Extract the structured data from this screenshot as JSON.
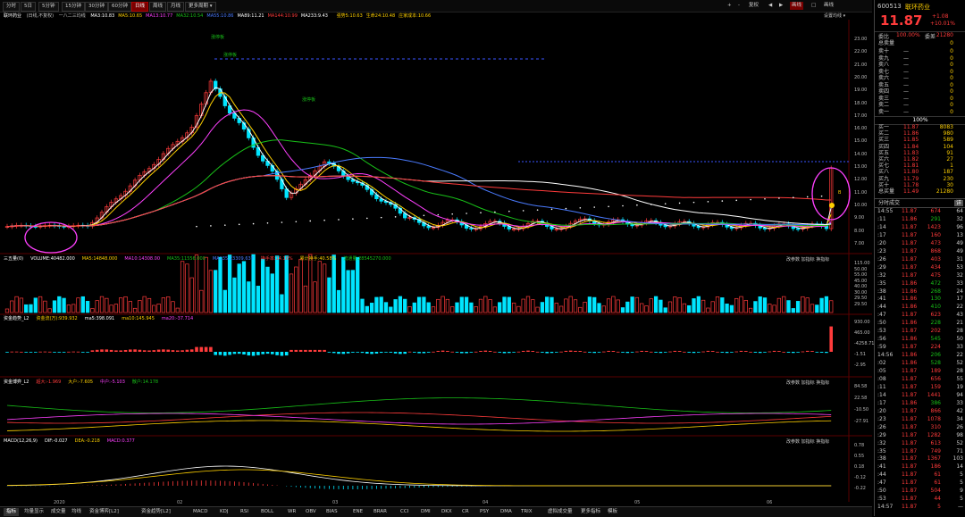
{
  "toolbar": {
    "periods": [
      "分时",
      "5日",
      "5分钟",
      "15分钟",
      "30分钟",
      "60分钟",
      "日线",
      "周线",
      "月线",
      "更多周期 ▾"
    ],
    "active_period": "日线",
    "right_controls": [
      "+",
      "-",
      "复权",
      "◀",
      "▶",
      "画线",
      "□",
      "画线"
    ]
  },
  "chart_info": {
    "stock_name": "联环药业",
    "mode": "(日线,不复权)",
    "fib": "一八二三均线",
    "ma": [
      {
        "label": "MA3:10.83",
        "color": "#ffffff"
      },
      {
        "label": "MA5:10.65",
        "color": "#ffd000"
      },
      {
        "label": "MA13:10.77",
        "color": "#ff40ff"
      },
      {
        "label": "MA32:10.54",
        "color": "#18c018"
      },
      {
        "label": "MA55:10.86",
        "color": "#4a7bff"
      },
      {
        "label": "MA89:11.21",
        "color": "#ffffff"
      },
      {
        "label": "MA144:10.99",
        "color": "#ff3b3b"
      },
      {
        "label": "MA233:9.43",
        "color": "#ffffff"
      }
    ],
    "extra": [
      "强势5:10.63",
      "生命24:10.48",
      "庄家成本:10.66"
    ],
    "settings": "设置均线 ▾"
  },
  "price_axis": [
    "23.00",
    "22.00",
    "21.00",
    "20.00",
    "19.00",
    "18.00",
    "17.00",
    "16.00",
    "15.00",
    "14.00",
    "13.00",
    "12.00",
    "11.00",
    "10.00",
    "9.00",
    "8.00",
    "7.00"
  ],
  "annotations": {
    "limit_up_1": "涨停板",
    "limit_up_2": "涨停板",
    "limit_up_3": "涨停板",
    "low_note": "45",
    "buy": "B"
  },
  "panels": {
    "volume": {
      "label": "三五量(0)",
      "items": [
        "VOLUME:40482.000",
        "MA5:14848.000",
        "MA10:14308.00",
        "MA35:11556.000",
        "MA135:23309.637",
        "换手率:14.16%",
        "累计换手:40.58%",
        "流通量:28545270.000"
      ],
      "buttons": [
        "改参数",
        "加指标",
        "换指标"
      ],
      "axis": [
        "115.00",
        "50.00",
        "55.00",
        "45.00",
        "40.00",
        "30.00",
        "29.50",
        "29.50"
      ]
    },
    "flow": {
      "label": "资金趋势_L2",
      "items": [
        "资金流(万):939.932",
        "ma5:398.091",
        "ma10:145.945",
        "ma20:-37.714"
      ],
      "axis": [
        "930.00",
        "465.00",
        "-4258.71",
        "-1.51",
        "-2.95"
      ]
    },
    "game": {
      "label": "资金博弈_L2",
      "items": [
        "超大:-1.969",
        "大户:-7.605",
        "中户:-5.103",
        "散户:14.178"
      ],
      "buttons": [
        "改参数",
        "加指标",
        "换指标"
      ],
      "axis": [
        "84.58",
        "22.58",
        "-10.50",
        "-27.91"
      ]
    },
    "macd": {
      "label": "MACD(12,26,9)",
      "items": [
        "DIF:-0.027",
        "DEA:-0.218",
        "MACD:0.377"
      ],
      "buttons": [
        "改参数",
        "加指标",
        "换指标"
      ],
      "axis": [
        "0.78",
        "0.55",
        "0.18",
        "-0.12",
        "-0.22"
      ]
    }
  },
  "xaxis": [
    "2020",
    "02",
    "03",
    "04",
    "05",
    "06"
  ],
  "bottom_tabs": [
    "指标",
    "均量显示",
    "成交量",
    "均线",
    "资金博弈[L2]",
    "资金趋势[L2]",
    "MACD",
    "KDJ",
    "RSI",
    "BOLL",
    "WR",
    "OBV",
    "BIAS",
    "ENE",
    "BRAR",
    "CCI",
    "DMI",
    "DKX",
    "CR",
    "PSY",
    "DMA",
    "TRIX",
    "虚拟成交量",
    "更多指标",
    "模板"
  ],
  "active_bottom_tab": "指标",
  "quote": {
    "code": "600513",
    "name": "联环药业",
    "price": "11.87",
    "change": "+1.08",
    "pct": "+10.01%",
    "weibi_label": "委比",
    "weibi": "100.00%",
    "weicha_label": "委差",
    "weicha": "21280",
    "total_sell_label": "总卖量",
    "total_sell": "0",
    "total_buy_label": "总买量",
    "total_buy_price": "11.49",
    "total_buy": "21280",
    "mid": "100%",
    "asks": [
      {
        "l": "卖十",
        "p": "—",
        "v": "0"
      },
      {
        "l": "卖九",
        "p": "—",
        "v": "0"
      },
      {
        "l": "卖八",
        "p": "—",
        "v": "0"
      },
      {
        "l": "卖七",
        "p": "—",
        "v": "0"
      },
      {
        "l": "卖六",
        "p": "—",
        "v": "0"
      },
      {
        "l": "卖五",
        "p": "—",
        "v": "0"
      },
      {
        "l": "卖四",
        "p": "—",
        "v": "0"
      },
      {
        "l": "卖三",
        "p": "—",
        "v": "0"
      },
      {
        "l": "卖二",
        "p": "—",
        "v": "0"
      },
      {
        "l": "卖一",
        "p": "—",
        "v": "0"
      }
    ],
    "bids": [
      {
        "l": "买一",
        "p": "11.87",
        "v": "8083"
      },
      {
        "l": "买二",
        "p": "11.86",
        "v": "980"
      },
      {
        "l": "买三",
        "p": "11.85",
        "v": "589"
      },
      {
        "l": "买四",
        "p": "11.84",
        "v": "104"
      },
      {
        "l": "买五",
        "p": "11.83",
        "v": "91"
      },
      {
        "l": "买六",
        "p": "11.82",
        "v": "27"
      },
      {
        "l": "买七",
        "p": "11.81",
        "v": "1"
      },
      {
        "l": "买八",
        "p": "11.80",
        "v": "187"
      },
      {
        "l": "买九",
        "p": "11.79",
        "v": "230"
      },
      {
        "l": "买十",
        "p": "11.78",
        "v": "30"
      }
    ],
    "trades_title": "分时成交",
    "trades_btn": "详",
    "trades": [
      {
        "t": "14:55",
        "p": "11.87",
        "v": "674",
        "d": "↑",
        "n": "64"
      },
      {
        "t": ":11",
        "p": "11.86",
        "v": "291",
        "d": "↓",
        "n": "32"
      },
      {
        "t": ":14",
        "p": "11.87",
        "v": "1423",
        "d": "↑",
        "n": "96"
      },
      {
        "t": ":17",
        "p": "11.87",
        "v": "160",
        "d": "↑",
        "n": "13"
      },
      {
        "t": ":20",
        "p": "11.87",
        "v": "473",
        "d": "↑",
        "n": "49"
      },
      {
        "t": ":23",
        "p": "11.87",
        "v": "868",
        "d": "↑",
        "n": "49"
      },
      {
        "t": ":26",
        "p": "11.87",
        "v": "403",
        "d": "↑",
        "n": "31"
      },
      {
        "t": ":29",
        "p": "11.87",
        "v": "434",
        "d": "↑",
        "n": "53"
      },
      {
        "t": ":32",
        "p": "11.87",
        "v": "475",
        "d": "↑",
        "n": "32"
      },
      {
        "t": ":35",
        "p": "11.86",
        "v": "472",
        "d": "↓",
        "n": "33"
      },
      {
        "t": ":38",
        "p": "11.86",
        "v": "268",
        "d": "↓",
        "n": "24"
      },
      {
        "t": ":41",
        "p": "11.86",
        "v": "130",
        "d": "↓",
        "n": "17"
      },
      {
        "t": ":44",
        "p": "11.86",
        "v": "410",
        "d": "↓",
        "n": "22"
      },
      {
        "t": ":47",
        "p": "11.87",
        "v": "623",
        "d": "↑",
        "n": "43"
      },
      {
        "t": ":50",
        "p": "11.86",
        "v": "228",
        "d": "↓",
        "n": "21"
      },
      {
        "t": ":53",
        "p": "11.87",
        "v": "202",
        "d": "↑",
        "n": "28"
      },
      {
        "t": ":56",
        "p": "11.86",
        "v": "545",
        "d": "↓",
        "n": "50"
      },
      {
        "t": ":59",
        "p": "11.87",
        "v": "224",
        "d": "↑",
        "n": "33"
      },
      {
        "t": "14:56",
        "p": "11.86",
        "v": "206",
        "d": "↓",
        "n": "22"
      },
      {
        "t": ":02",
        "p": "11.86",
        "v": "528",
        "d": "↓",
        "n": "52"
      },
      {
        "t": ":05",
        "p": "11.87",
        "v": "189",
        "d": "↑",
        "n": "28"
      },
      {
        "t": ":08",
        "p": "11.87",
        "v": "656",
        "d": "↑",
        "n": "55"
      },
      {
        "t": ":11",
        "p": "11.87",
        "v": "159",
        "d": "↑",
        "n": "19"
      },
      {
        "t": ":14",
        "p": "11.87",
        "v": "1441",
        "d": "↑",
        "n": "94"
      },
      {
        "t": ":17",
        "p": "11.86",
        "v": "386",
        "d": "↓",
        "n": "33"
      },
      {
        "t": ":20",
        "p": "11.87",
        "v": "866",
        "d": "↑",
        "n": "42"
      },
      {
        "t": ":23",
        "p": "11.87",
        "v": "1078",
        "d": "↑",
        "n": "34"
      },
      {
        "t": ":26",
        "p": "11.87",
        "v": "310",
        "d": "↑",
        "n": "26"
      },
      {
        "t": ":29",
        "p": "11.87",
        "v": "1282",
        "d": "↑",
        "n": "98"
      },
      {
        "t": ":32",
        "p": "11.87",
        "v": "613",
        "d": "↑",
        "n": "52"
      },
      {
        "t": ":35",
        "p": "11.87",
        "v": "749",
        "d": "↑",
        "n": "71"
      },
      {
        "t": ":38",
        "p": "11.87",
        "v": "1367",
        "d": "↑",
        "n": "103"
      },
      {
        "t": ":41",
        "p": "11.87",
        "v": "186",
        "d": "↑",
        "n": "14"
      },
      {
        "t": ":44",
        "p": "11.87",
        "v": "61",
        "d": "↑",
        "n": "5"
      },
      {
        "t": ":47",
        "p": "11.87",
        "v": "61",
        "d": "↑",
        "n": "5"
      },
      {
        "t": ":50",
        "p": "11.87",
        "v": "504",
        "d": "↑",
        "n": "9"
      },
      {
        "t": ":53",
        "p": "11.87",
        "v": "44",
        "d": "↑",
        "n": "5"
      },
      {
        "t": "14:57",
        "p": "11.87",
        "v": "5",
        "d": "↑",
        "n": "—"
      }
    ]
  },
  "colors": {
    "up": "#ff3b3b",
    "down": "#00e5ff",
    "ma_yellow": "#ffd000",
    "ma_white": "#ffffff",
    "ma_mag": "#ff40ff",
    "ma_green": "#18c018",
    "ma_blue": "#4a7bff"
  }
}
